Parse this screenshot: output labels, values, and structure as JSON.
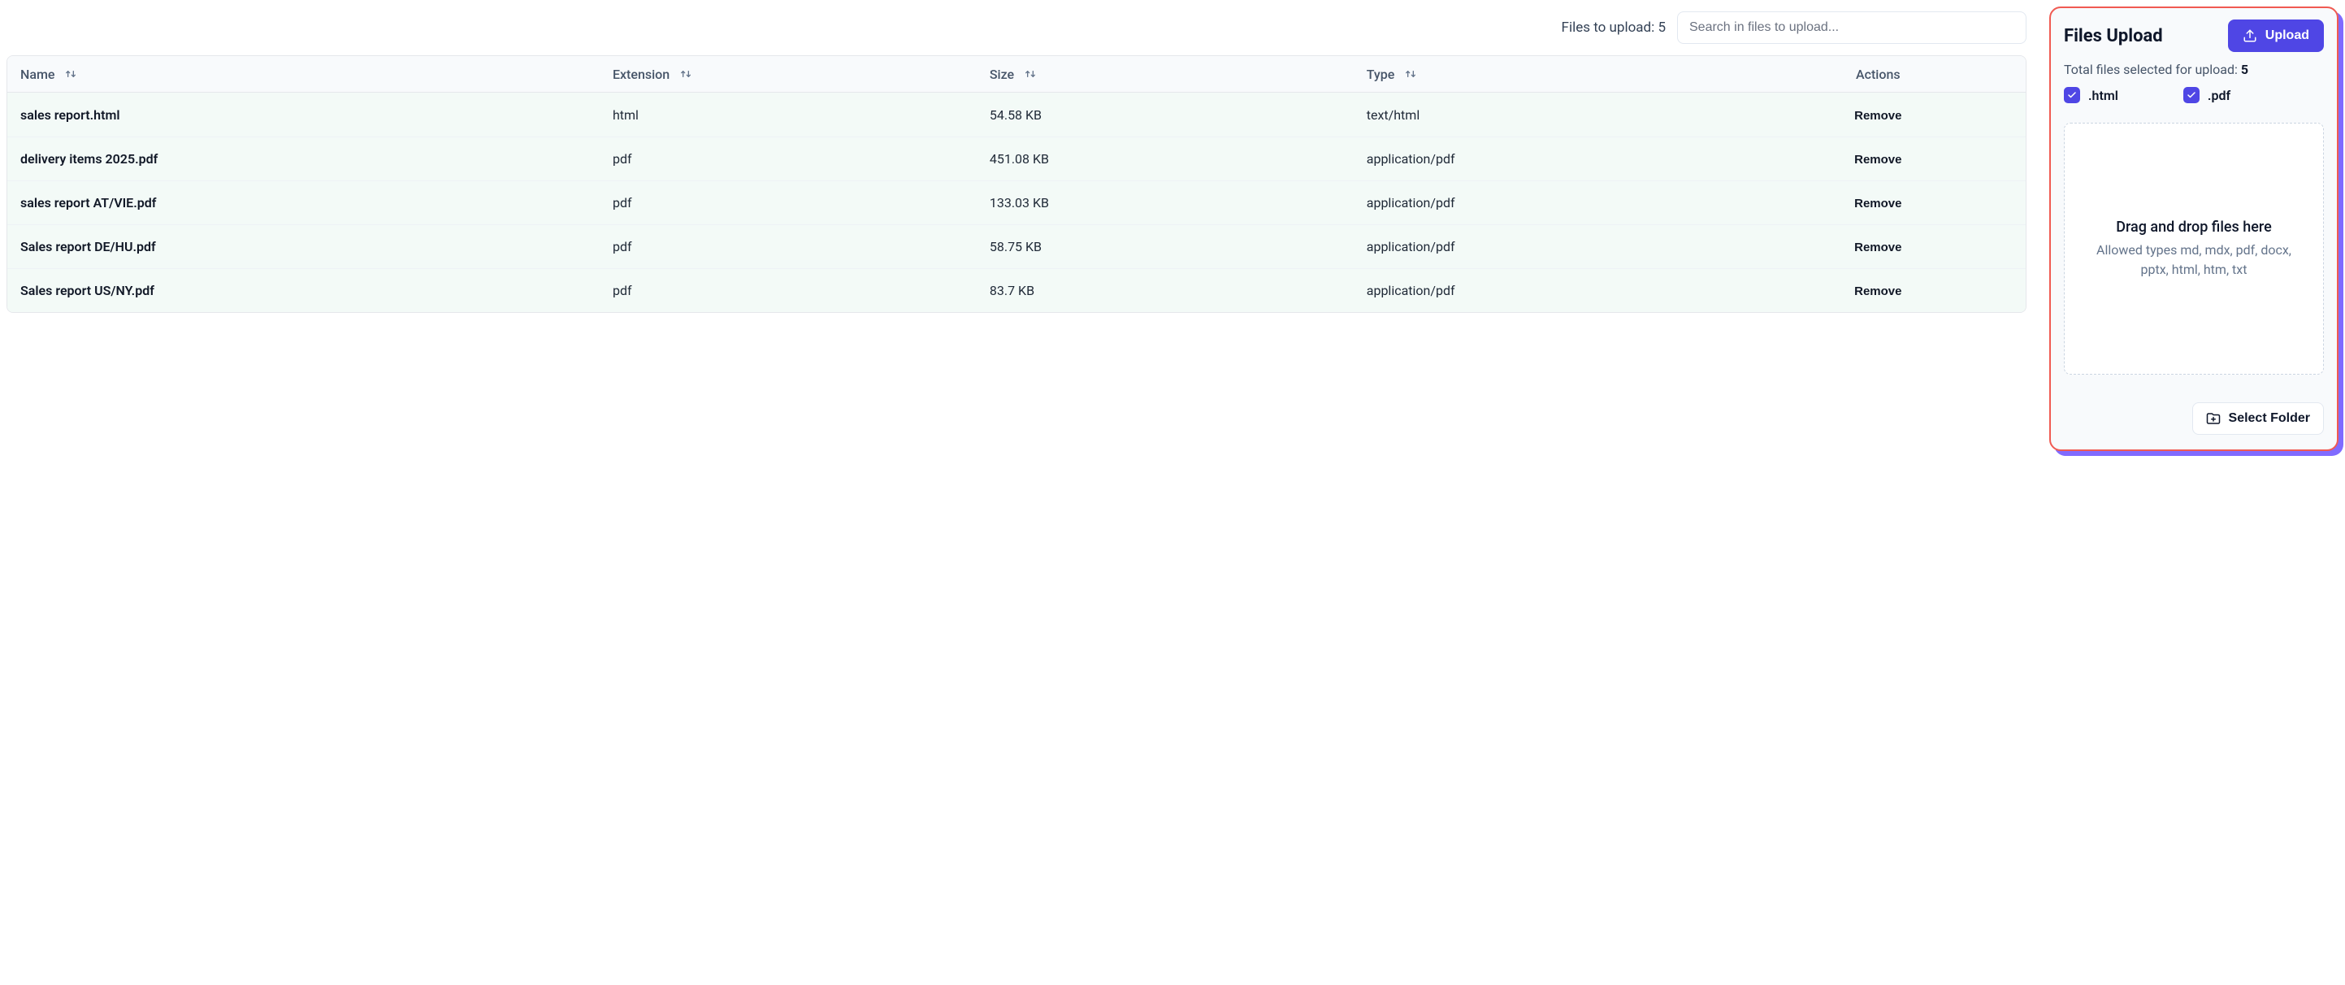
{
  "toolbar": {
    "files_to_upload_label": "Files to upload: 5",
    "search_placeholder": "Search in files to upload..."
  },
  "table": {
    "headers": {
      "name": "Name",
      "extension": "Extension",
      "size": "Size",
      "type": "Type",
      "actions": "Actions"
    },
    "remove_label": "Remove",
    "rows": [
      {
        "name": "sales report.html",
        "extension": "html",
        "size": "54.58 KB",
        "type": "text/html"
      },
      {
        "name": "delivery items 2025.pdf",
        "extension": "pdf",
        "size": "451.08 KB",
        "type": "application/pdf"
      },
      {
        "name": "sales report AT/VIE.pdf",
        "extension": "pdf",
        "size": "133.03 KB",
        "type": "application/pdf"
      },
      {
        "name": "Sales report DE/HU.pdf",
        "extension": "pdf",
        "size": "58.75 KB",
        "type": "application/pdf"
      },
      {
        "name": "Sales report US/NY.pdf",
        "extension": "pdf",
        "size": "83.7 KB",
        "type": "application/pdf"
      }
    ]
  },
  "panel": {
    "title": "Files Upload",
    "upload_button": "Upload",
    "total_label": "Total files selected for upload: ",
    "total_count": "5",
    "filters": [
      {
        "label": ".html",
        "checked": true
      },
      {
        "label": ".pdf",
        "checked": true
      }
    ],
    "drop_title": "Drag and drop files here",
    "drop_subtitle": "Allowed types md, mdx, pdf, docx, pptx, html, htm, txt",
    "select_folder": "Select Folder"
  }
}
